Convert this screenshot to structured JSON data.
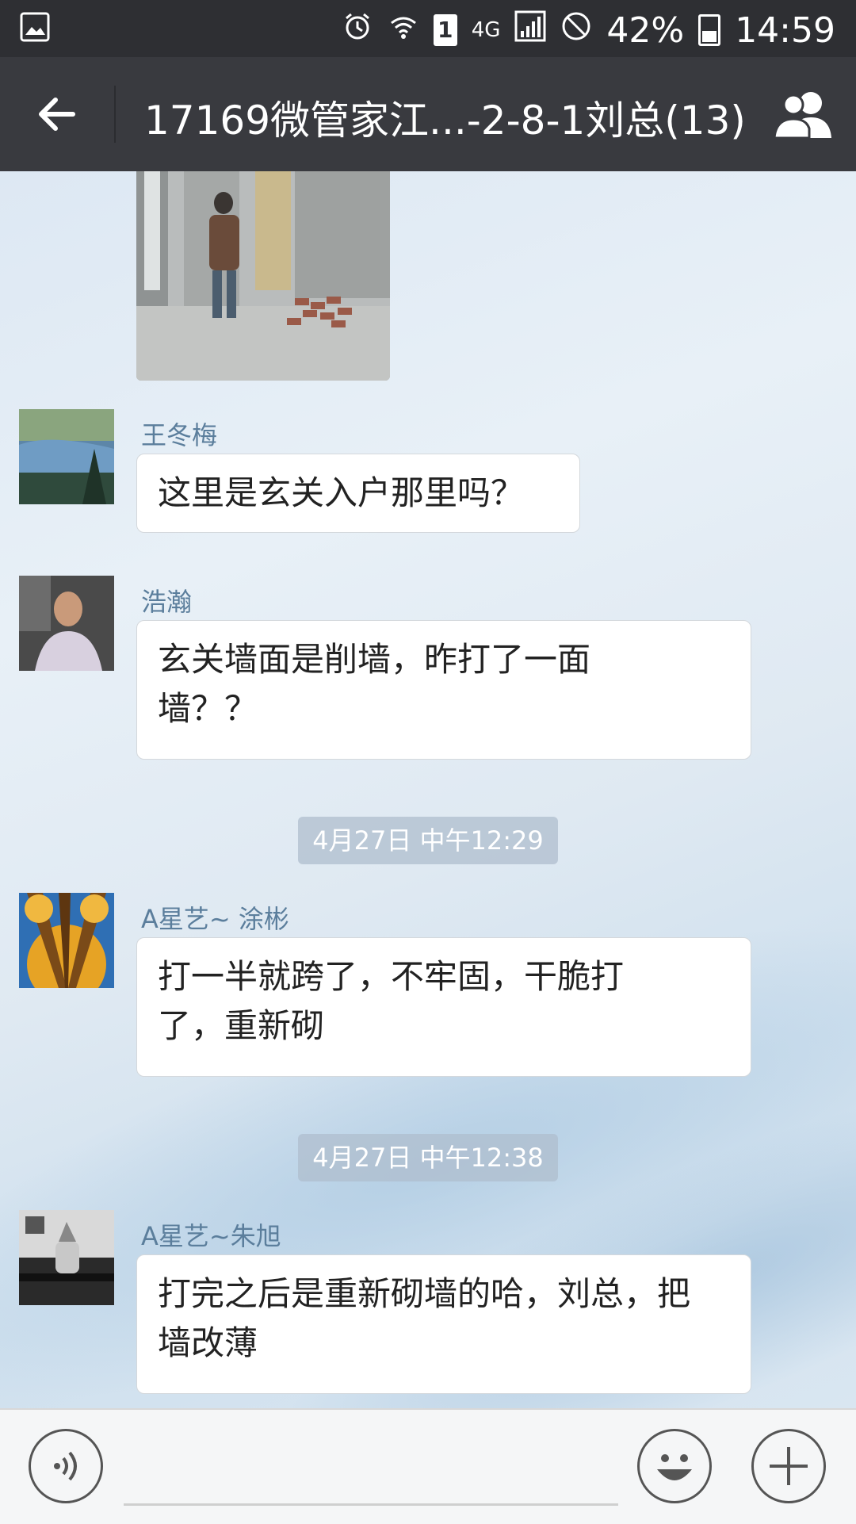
{
  "status_bar": {
    "network": "4G",
    "sim_slot": "1",
    "battery": "42%",
    "time": "14:59"
  },
  "header": {
    "title": "17169微管家江...-2-8-1刘总(13)"
  },
  "messages": [
    {
      "sender": "王冬梅",
      "text": "这里是玄关入户那里吗？"
    },
    {
      "sender": "浩瀚",
      "text": "玄关墙面是削墙，昨打了一面墙？？"
    },
    {
      "sender": "A星艺~ 涂彬",
      "text": "打一半就跨了，不牢固，干脆打了，重新砌"
    },
    {
      "sender": "A星艺~朱旭",
      "text": "打完之后是重新砌墙的哈，刘总，把墙改薄"
    }
  ],
  "timestamps": [
    "4月27日 中午12:29",
    "4月27日 中午12:38"
  ],
  "colors": {
    "title_bar": "#393a3f",
    "status_bar": "#2e2f33",
    "sender_name": "#5b7e9c"
  }
}
